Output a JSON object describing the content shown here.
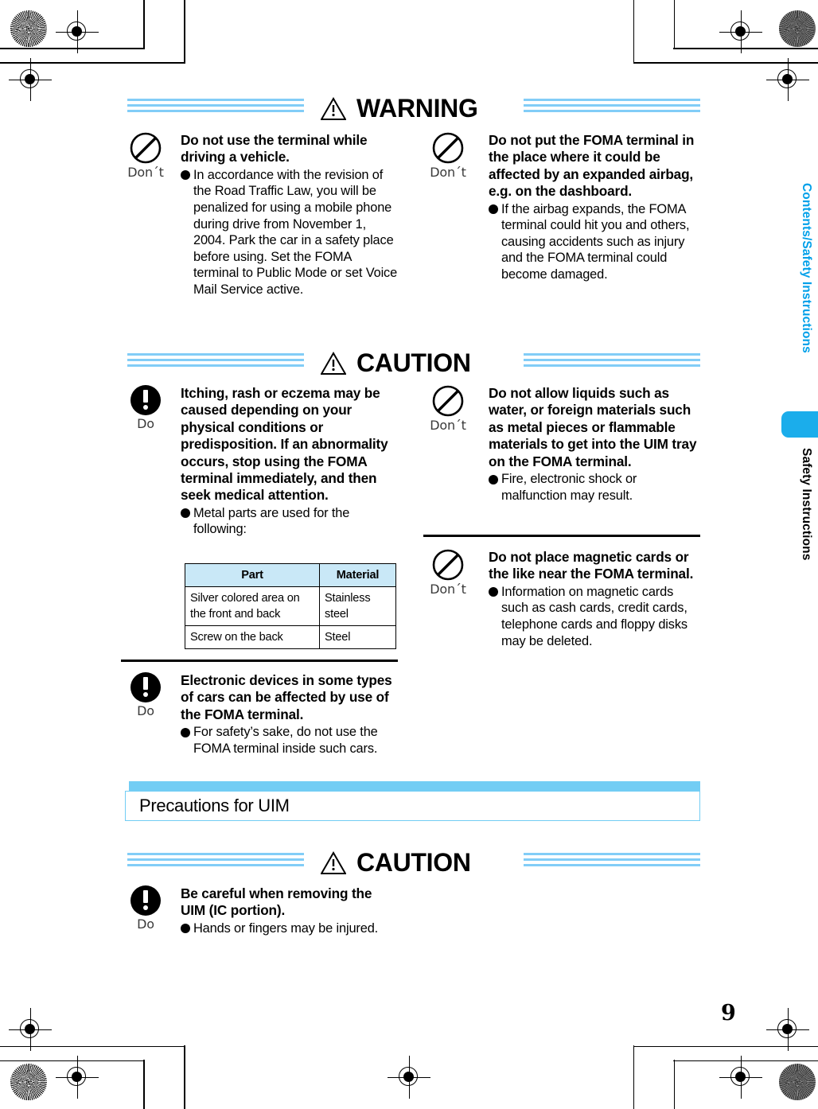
{
  "page": {
    "number": "9",
    "sidebar": {
      "chapter_label": "Contents/Safety Instructions",
      "section_label": "Safety Instructions",
      "tab_color": "#1badeb"
    }
  },
  "sections": [
    {
      "id": "warning",
      "title": "WARNING",
      "icon": "warning-triangle-icon",
      "items": [
        {
          "column": "left",
          "mark": "dont",
          "mark_label": "Don´t",
          "heading": "Do not use the terminal while driving a vehicle.",
          "body": "In accordance with the revision of the Road Traffic Law, you will be penalized for using a mobile phone during drive from November 1, 2004. Park the car in a safety place before using. Set the FOMA terminal to Public Mode or set Voice Mail Service active."
        },
        {
          "column": "right",
          "mark": "dont",
          "mark_label": "Don´t",
          "heading": "Do not put the FOMA terminal in the place where it could be affected by an expanded airbag, e.g. on the dashboard.",
          "body": "If the airbag expands, the FOMA terminal could hit you and others, causing accidents such as injury and the FOMA terminal could become damaged."
        }
      ]
    },
    {
      "id": "caution-main",
      "title": "CAUTION",
      "icon": "warning-triangle-icon",
      "items": [
        {
          "column": "left",
          "mark": "do",
          "mark_label": "Do",
          "heading": "Itching, rash or eczema may be caused depending on your physical conditions or predisposition. If an abnormality occurs, stop using the FOMA terminal immediately, and then seek medical attention.",
          "body": "Metal parts are used for the following:"
        },
        {
          "column": "left",
          "mark": "do",
          "mark_label": "Do",
          "heading": "Electronic devices in some types of cars can be affected by use of the FOMA terminal.",
          "body": "For safety’s sake, do not use the FOMA terminal inside such cars."
        },
        {
          "column": "right",
          "mark": "dont",
          "mark_label": "Don´t",
          "heading": "Do not allow liquids such as water, or foreign materials such as metal pieces or flammable materials to get into the UIM tray on the FOMA terminal.",
          "body": "Fire, electronic shock or malfunction may result."
        },
        {
          "column": "right",
          "mark": "dont",
          "mark_label": "Don´t",
          "heading": "Do not place magnetic cards or the like near the FOMA terminal.",
          "body": "Information on magnetic cards such as cash cards, credit cards, telephone cards and floppy disks may be deleted."
        }
      ],
      "table": {
        "headers": [
          "Part",
          "Material"
        ],
        "rows": [
          [
            "Silver colored area on the front and back",
            "Stainless steel"
          ],
          [
            "Screw on the back",
            "Steel"
          ]
        ],
        "header_bg": "#c9e8f7"
      }
    },
    {
      "id": "uim-band",
      "band_title": "Precautions for UIM",
      "band_color": "#72cdf4"
    },
    {
      "id": "caution-uim",
      "title": "CAUTION",
      "icon": "warning-triangle-icon",
      "items": [
        {
          "column": "left",
          "mark": "do",
          "mark_label": "Do",
          "heading": "Be careful when removing the UIM (IC portion).",
          "body": "Hands or fingers may be injured."
        }
      ]
    }
  ]
}
